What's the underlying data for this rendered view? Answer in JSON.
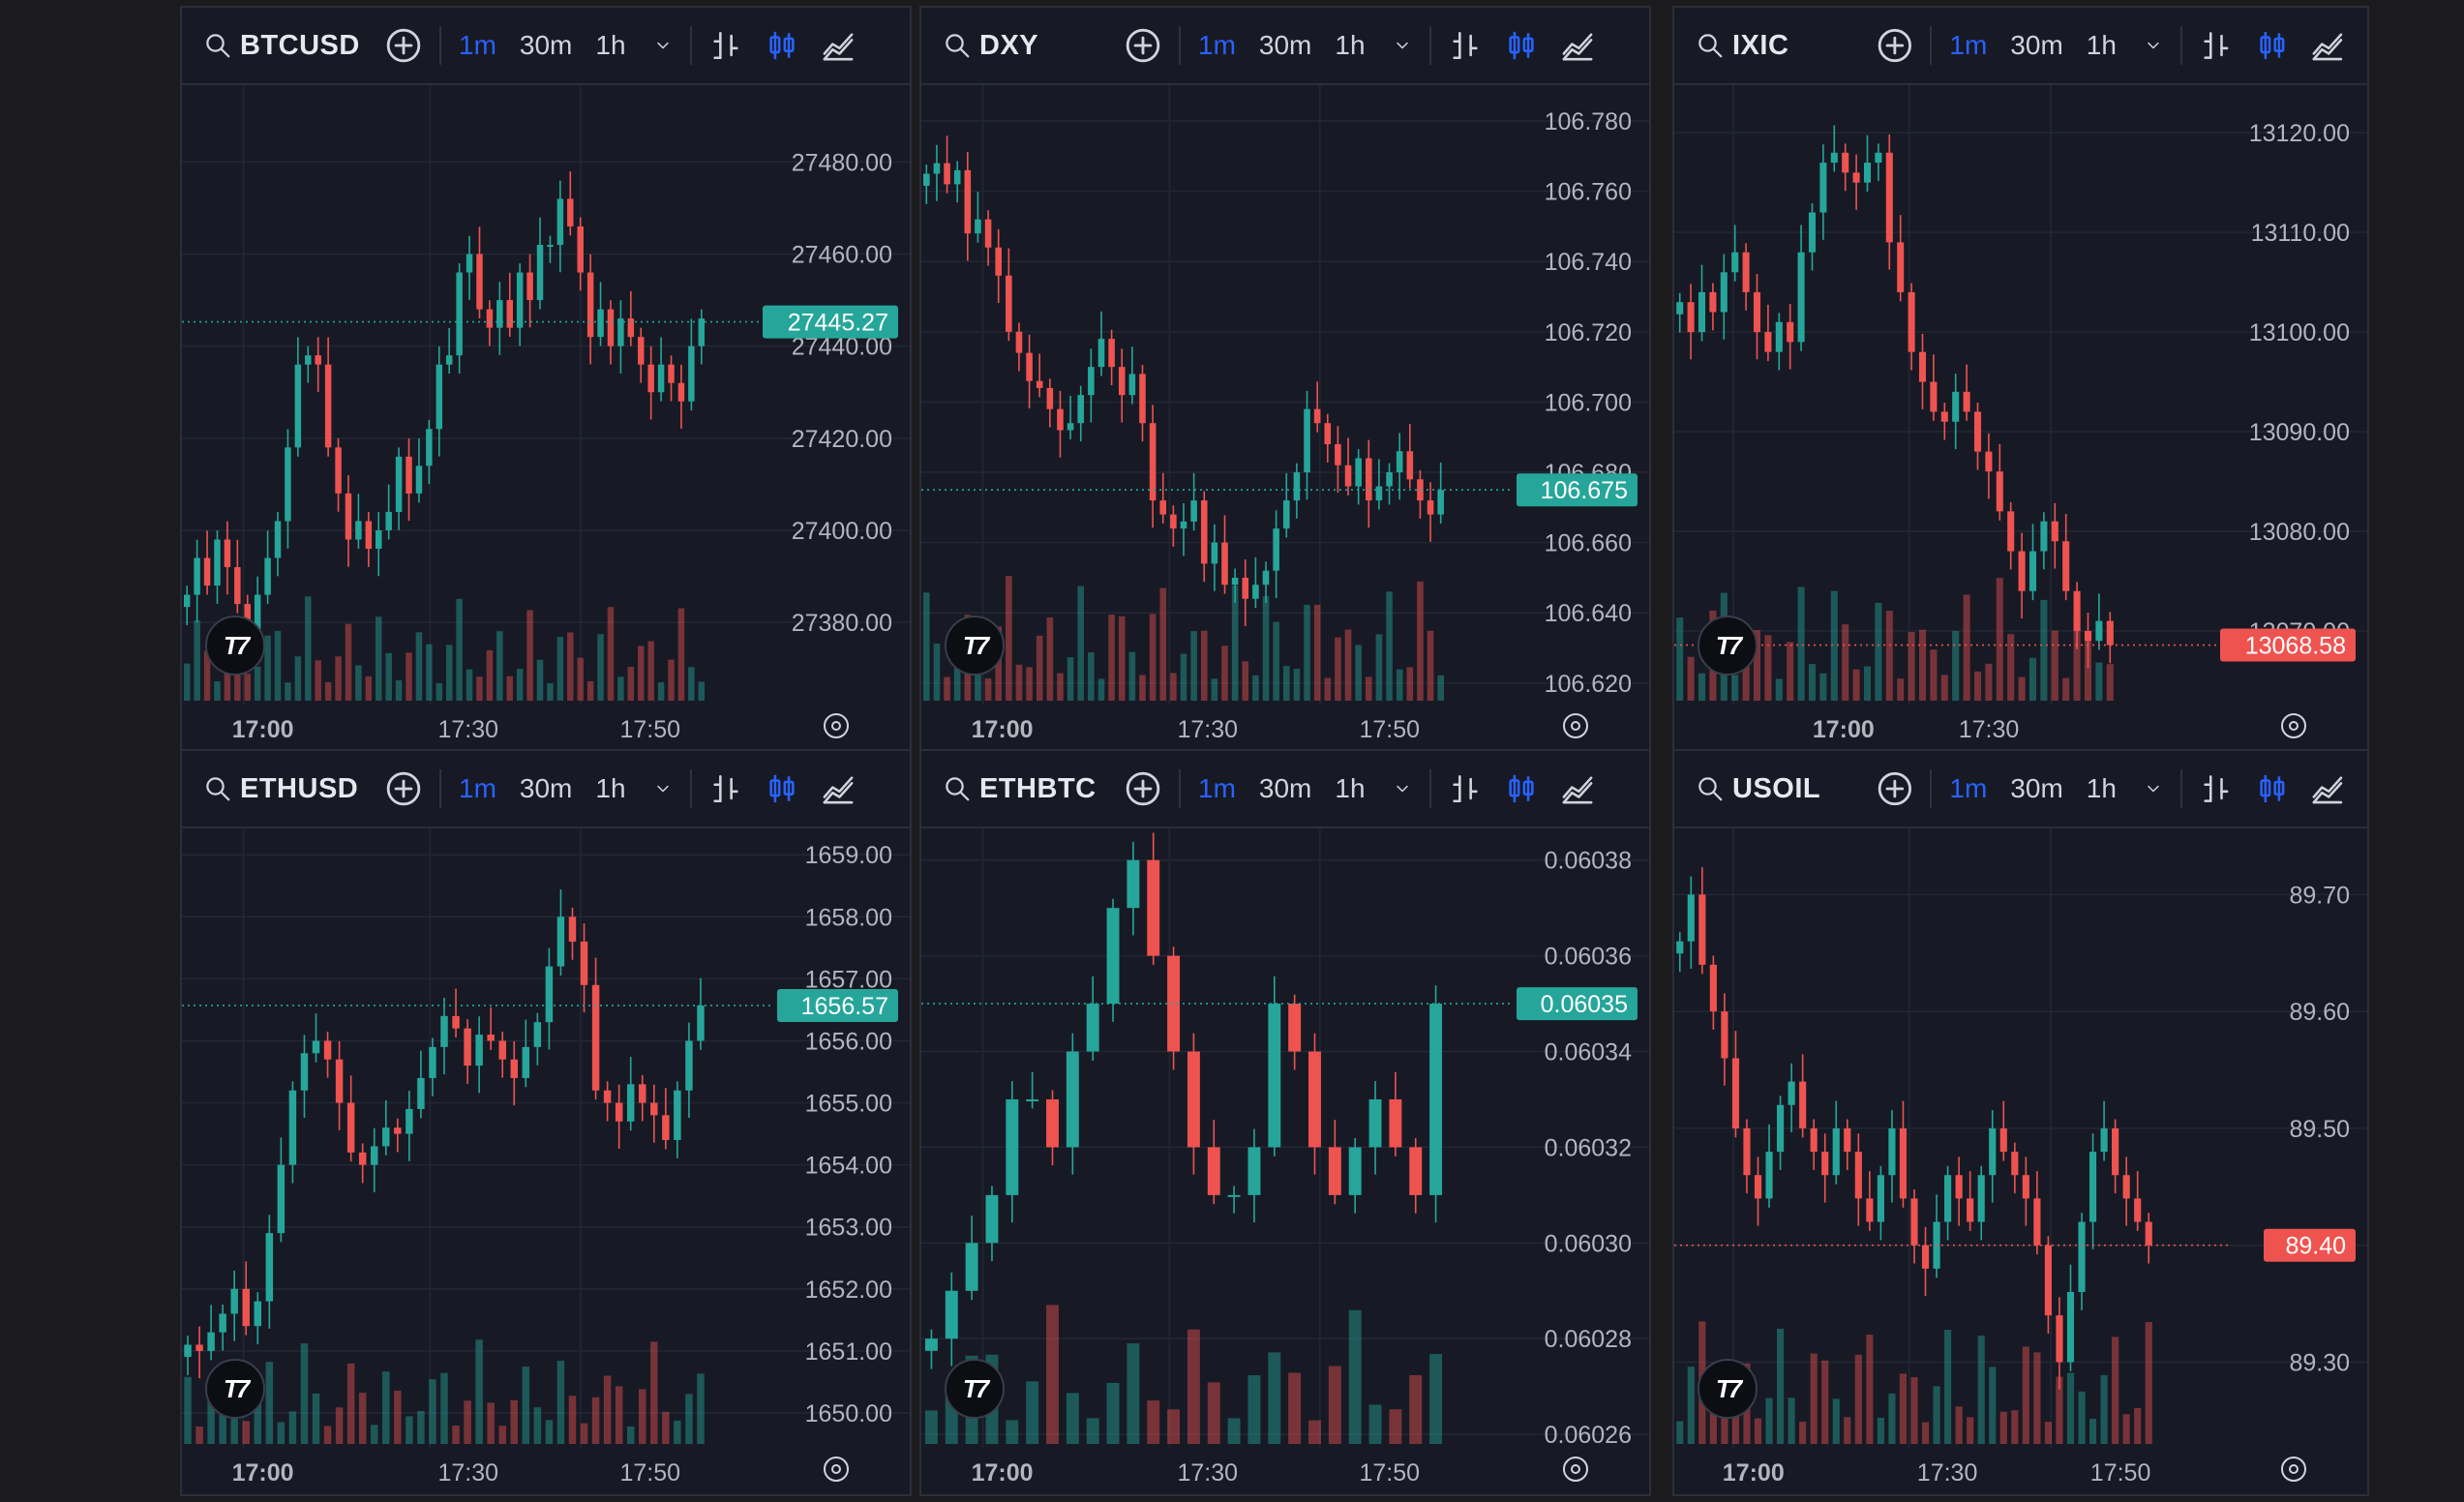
{
  "colors": {
    "up": "#26a69a",
    "down": "#ef5350",
    "bg": "#171a25",
    "grid": "#232735",
    "accent": "#2962ff",
    "text": "#d1d4dc"
  },
  "toolbar": {
    "intervals": [
      "1m",
      "30m",
      "1h"
    ],
    "active_interval": "1m",
    "icons": [
      "search-icon",
      "add-symbol-icon",
      "chevron-down-icon",
      "bar-chart-icon",
      "candle-chart-icon",
      "area-chart-icon"
    ]
  },
  "panels": [
    {
      "symbol": "BTCUSD",
      "last_label": "27445.27",
      "last_value": 27445.27,
      "last_color": "up",
      "y_ticks": [
        "27480.00",
        "27460.00",
        "27440.00",
        "27420.00",
        "27400.00",
        "27380.00"
      ],
      "y_values": [
        27480,
        27460,
        27440,
        27420,
        27400,
        27380
      ],
      "ymin": 27363,
      "ymax": 27495,
      "x_ticks": [
        "17:00",
        "17:30",
        "17:50"
      ],
      "chart_data": {
        "type": "candlestick",
        "series": [
          {
            "name": "BTCUSD",
            "close": [
              27386,
              27394,
              27388,
              27398,
              27392,
              27384,
              27378,
              27386,
              27394,
              27402,
              27418,
              27436,
              27438,
              27436,
              27418,
              27408,
              27398,
              27402,
              27396,
              27400,
              27404,
              27416,
              27408,
              27414,
              27422,
              27436,
              27438,
              27456,
              27460,
              27448,
              27444,
              27450,
              27444,
              27456,
              27450,
              27462,
              27462,
              27472,
              27466,
              27456,
              27442,
              27448,
              27440,
              27446,
              27442,
              27436,
              27430,
              27436,
              27432,
              27428,
              27440,
              27446
            ]
          }
        ]
      }
    },
    {
      "symbol": "DXY",
      "last_label": "106.675",
      "last_value": 106.675,
      "last_color": "up",
      "y_ticks": [
        "106.780",
        "106.760",
        "106.740",
        "106.720",
        "106.700",
        "106.680",
        "106.660",
        "106.640",
        "106.620"
      ],
      "y_values": [
        106.78,
        106.76,
        106.74,
        106.72,
        106.7,
        106.68,
        106.66,
        106.64,
        106.62
      ],
      "ymin": 106.615,
      "ymax": 106.788,
      "x_ticks": [
        "17:00",
        "17:30",
        "17:50"
      ],
      "chart_data": {
        "type": "candlestick",
        "series": [
          {
            "name": "DXY",
            "close": [
              106.765,
              106.768,
              106.762,
              106.766,
              106.748,
              106.752,
              106.744,
              106.736,
              106.72,
              106.714,
              106.706,
              106.704,
              106.698,
              106.692,
              106.694,
              106.702,
              106.71,
              106.718,
              106.71,
              106.702,
              106.708,
              106.694,
              106.672,
              106.668,
              106.664,
              106.666,
              106.672,
              106.654,
              106.66,
              106.648,
              106.65,
              106.644,
              106.648,
              106.652,
              106.664,
              106.672,
              106.68,
              106.698,
              106.694,
              106.688,
              106.682,
              106.676,
              106.684,
              106.672,
              106.676,
              106.68,
              106.686,
              106.678,
              106.672,
              106.668,
              106.675
            ]
          }
        ]
      }
    },
    {
      "symbol": "IXIC",
      "last_label": "13068.58",
      "last_value": 13068.58,
      "last_color": "down",
      "y_ticks": [
        "13120.00",
        "13110.00",
        "13100.00",
        "13090.00",
        "13080.00",
        "13070.00"
      ],
      "y_values": [
        13120,
        13110,
        13100,
        13090,
        13080,
        13070
      ],
      "ymin": 13063,
      "ymax": 13124,
      "x_ticks": [
        "17:00",
        "17:30"
      ],
      "chart_data": {
        "type": "candlestick",
        "series": [
          {
            "name": "IXIC",
            "close": [
              13103,
              13100,
              13104,
              13102,
              13106,
              13108,
              13104,
              13100,
              13098,
              13101,
              13099,
              13108,
              13112,
              13117,
              13118,
              13116,
              13115,
              13117,
              13118,
              13109,
              13104,
              13098,
              13095,
              13092,
              13091,
              13094,
              13092,
              13088,
              13086,
              13082,
              13078,
              13074,
              13078,
              13081,
              13079,
              13074,
              13070,
              13069,
              13071,
              13068.58
            ]
          }
        ]
      }
    },
    {
      "symbol": "ETHUSD",
      "last_label": "1656.57",
      "last_value": 1656.57,
      "last_color": "up",
      "y_ticks": [
        "1659.00",
        "1658.00",
        "1657.00",
        "1656.00",
        "1655.00",
        "1654.00",
        "1653.00",
        "1652.00",
        "1651.00",
        "1650.00"
      ],
      "y_values": [
        1659,
        1658,
        1657,
        1656,
        1655,
        1654,
        1653,
        1652,
        1651,
        1650
      ],
      "ymin": 1649.5,
      "ymax": 1659.3,
      "x_ticks": [
        "17:00",
        "17:30",
        "17:50"
      ],
      "chart_data": {
        "type": "candlestick",
        "series": [
          {
            "name": "ETHUSD",
            "close": [
              1651.1,
              1651.0,
              1651.3,
              1651.6,
              1652.0,
              1651.4,
              1651.8,
              1652.9,
              1654.0,
              1655.2,
              1655.8,
              1656.0,
              1655.7,
              1655.0,
              1654.2,
              1654.0,
              1654.3,
              1654.6,
              1654.5,
              1654.9,
              1655.4,
              1655.9,
              1656.4,
              1656.2,
              1655.6,
              1656.1,
              1656.0,
              1655.7,
              1655.4,
              1655.9,
              1656.3,
              1657.2,
              1658.0,
              1657.6,
              1656.9,
              1655.2,
              1655.0,
              1654.7,
              1655.3,
              1655.0,
              1654.8,
              1654.4,
              1655.2,
              1656.0,
              1656.57
            ]
          }
        ]
      }
    },
    {
      "symbol": "ETHBTC",
      "last_label": "0.06035",
      "last_value": 0.06035,
      "last_color": "up",
      "y_ticks": [
        "0.06038",
        "0.06036",
        "0.06034",
        "0.06032",
        "0.06030",
        "0.06028",
        "0.06026"
      ],
      "y_values": [
        0.06038,
        0.06036,
        0.06034,
        0.06032,
        0.0603,
        0.06028,
        0.06026
      ],
      "ymin": 0.060258,
      "ymax": 0.060385,
      "x_ticks": [
        "17:00",
        "17:30",
        "17:50"
      ],
      "chart_data": {
        "type": "candlestick",
        "series": [
          {
            "name": "ETHBTC",
            "close": [
              0.06028,
              0.06029,
              0.0603,
              0.06031,
              0.06033,
              0.06033,
              0.06032,
              0.06034,
              0.06035,
              0.06037,
              0.06038,
              0.06036,
              0.06034,
              0.06032,
              0.06031,
              0.06031,
              0.06032,
              0.06035,
              0.06034,
              0.06032,
              0.06031,
              0.06032,
              0.06033,
              0.06032,
              0.06031,
              0.06035
            ]
          }
        ]
      }
    },
    {
      "symbol": "USOIL",
      "last_label": "89.40",
      "last_value": 89.4,
      "last_color": "down",
      "y_ticks": [
        "89.70",
        "89.60",
        "89.50",
        "89.40",
        "89.30"
      ],
      "y_values": [
        89.7,
        89.6,
        89.5,
        89.4,
        89.3
      ],
      "ymin": 89.23,
      "ymax": 89.75,
      "x_ticks": [
        "17:00",
        "17:30",
        "17:50"
      ],
      "chart_data": {
        "type": "candlestick",
        "series": [
          {
            "name": "USOIL",
            "close": [
              89.66,
              89.7,
              89.64,
              89.6,
              89.56,
              89.5,
              89.46,
              89.44,
              89.48,
              89.52,
              89.54,
              89.5,
              89.48,
              89.46,
              89.5,
              89.48,
              89.44,
              89.42,
              89.46,
              89.5,
              89.44,
              89.4,
              89.38,
              89.42,
              89.46,
              89.44,
              89.42,
              89.46,
              89.5,
              89.48,
              89.46,
              89.44,
              89.4,
              89.34,
              89.3,
              89.36,
              89.42,
              89.48,
              89.5,
              89.46,
              89.44,
              89.42,
              89.4
            ]
          }
        ]
      }
    }
  ]
}
